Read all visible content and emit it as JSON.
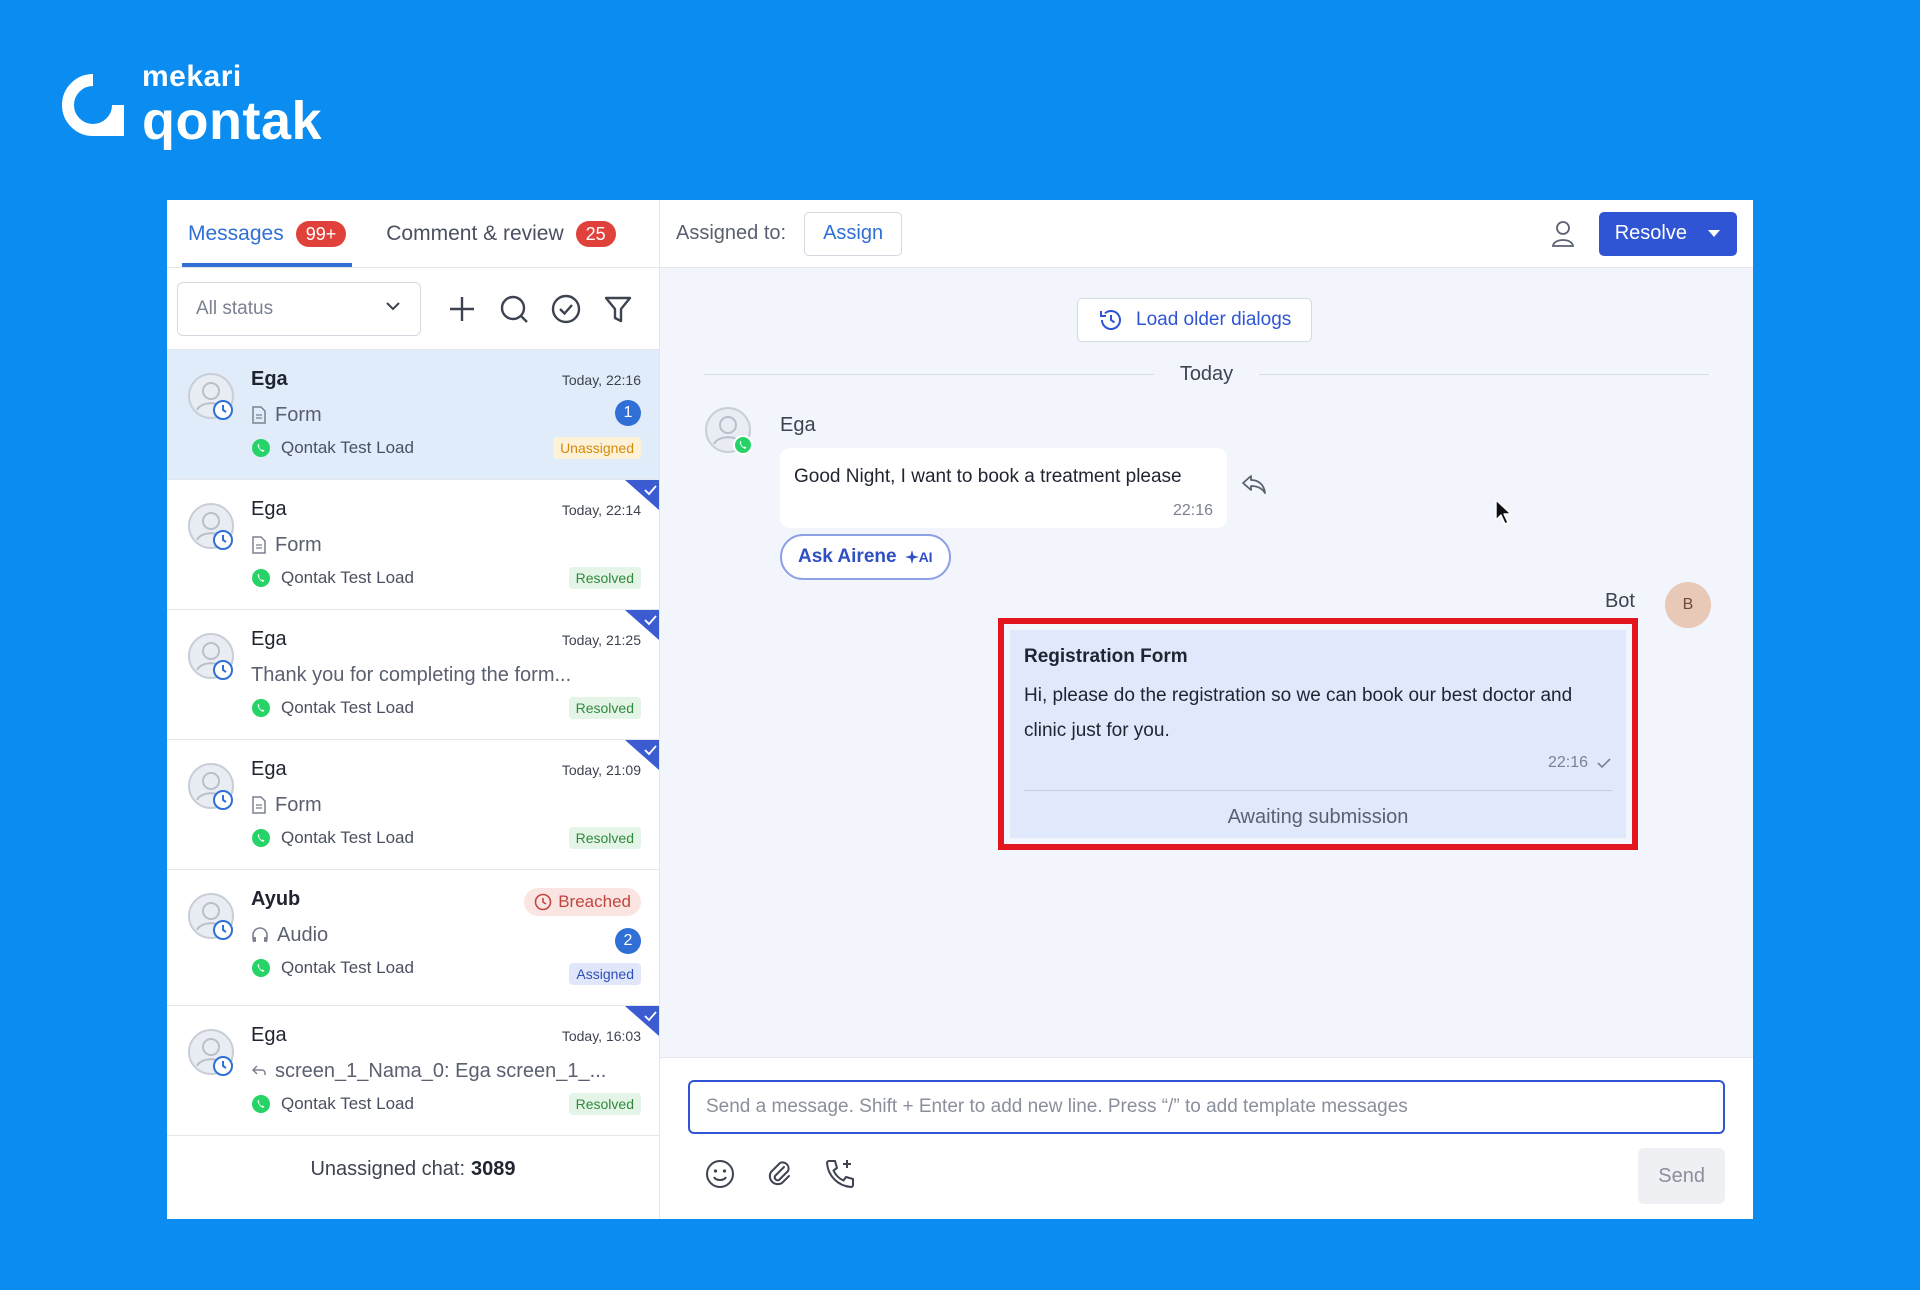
{
  "brand": {
    "line1": "mekari",
    "line2": "qontak"
  },
  "colors": {
    "background": "#0a8cf0",
    "accent": "#2f55d4",
    "badge": "#e0413b",
    "highlight": "#e3161f",
    "whatsapp": "#25d366"
  },
  "tabs": [
    {
      "label": "Messages",
      "count": "99+",
      "active": true
    },
    {
      "label": "Comment & review",
      "count": "25",
      "active": false
    }
  ],
  "filter": {
    "status": "All status"
  },
  "conversations": [
    {
      "name": "Ega",
      "time": "Today, 22:16",
      "preview": "Form",
      "preview_icon": "document-icon",
      "channel": "Qontak Test Load",
      "status": "Unassigned",
      "unread": "1",
      "selected": true
    },
    {
      "name": "Ega",
      "time": "Today, 22:14",
      "preview": "Form",
      "preview_icon": "document-icon",
      "channel": "Qontak Test Load",
      "status": "Resolved"
    },
    {
      "name": "Ega",
      "time": "Today, 21:25",
      "preview": "Thank you for completing the form...",
      "channel": "Qontak Test Load",
      "status": "Resolved"
    },
    {
      "name": "Ega",
      "time": "Today, 21:09",
      "preview": "Form",
      "preview_icon": "document-icon",
      "channel": "Qontak Test Load",
      "status": "Resolved"
    },
    {
      "name": "Ayub",
      "breached": "Breached",
      "preview": "Audio",
      "preview_icon": "headphones-icon",
      "channel": "Qontak Test Load",
      "status": "Assigned",
      "unread": "2"
    },
    {
      "name": "Ega",
      "time": "Today, 16:03",
      "preview": "screen_1_Nama_0: Ega screen_1_...",
      "preview_icon": "reply-arrow-icon",
      "channel": "Qontak Test Load",
      "status": "Resolved"
    }
  ],
  "footer": {
    "label": "Unassigned chat:",
    "count": "3089"
  },
  "header": {
    "assigned_label": "Assigned to:",
    "assign_button": "Assign",
    "resolve_button": "Resolve"
  },
  "chat": {
    "load_older": "Load older dialogs",
    "date_divider": "Today",
    "incoming": {
      "sender": "Ega",
      "text": "Good Night, I want to book a treatment please",
      "time": "22:16"
    },
    "ask_button": "Ask Airene",
    "ai_tag": "AI",
    "bot": {
      "name": "Bot",
      "avatar_initial": "B",
      "title": "Registration Form",
      "text": "Hi, please do the registration so we can book our best doctor and clinic just for you.",
      "time": "22:16",
      "footer": "Awaiting submission"
    }
  },
  "composer": {
    "placeholder": "Send a message. Shift + Enter to add new line. Press “/” to add template messages",
    "send": "Send"
  }
}
